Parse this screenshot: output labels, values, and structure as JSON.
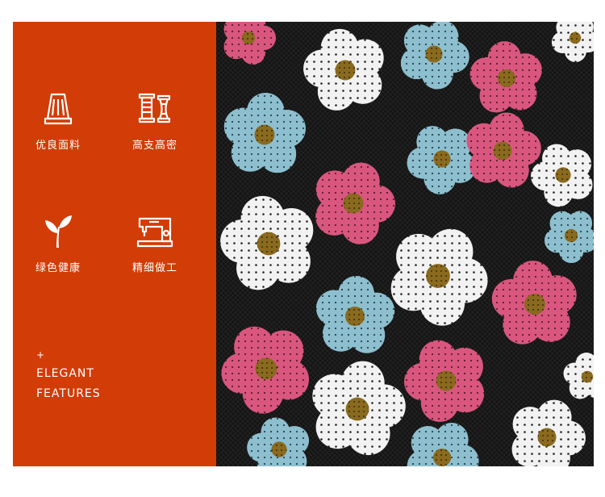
{
  "features": [
    {
      "label": "优良面料",
      "icon": "thimble-icon"
    },
    {
      "label": "高支高密",
      "icon": "thread-spools-icon"
    },
    {
      "label": "绿色健康",
      "icon": "sprout-icon"
    },
    {
      "label": "精细做工",
      "icon": "sewing-machine-icon"
    }
  ],
  "tagline": {
    "plus": "+",
    "line1": "ELEGANT",
    "line2": "FEATURES"
  },
  "colors": {
    "panel": "#d23c07",
    "icon_stroke": "#ffffff",
    "fabric_bg": "#151515",
    "sequin_white": "#f2f2f2",
    "sequin_pink": "#d9577f",
    "sequin_blue": "#8dbfcf",
    "sequin_gold": "#8a6a1e"
  }
}
